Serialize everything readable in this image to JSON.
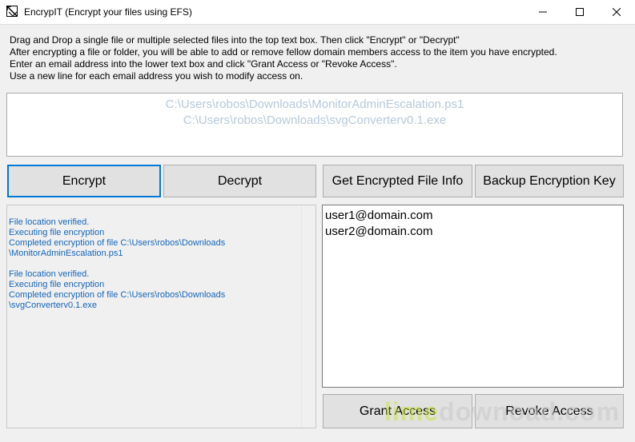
{
  "window": {
    "title": "EncrypIT (Encrypt your files using EFS)"
  },
  "instructions": [
    "Drag and Drop a single file or multiple selected files into the top text box. Then click \"Encrypt\" or \"Decrypt\"",
    "After encrypting a file or folder, you will be able to add or remove fellow domain members access to the item you have encrypted.",
    "Enter an email address into the lower text box and click \"Grant Access or \"Revoke Access\".",
    "Use a new line for each email address you wish to modify access on."
  ],
  "files": [
    "C:\\Users\\robos\\Downloads\\MonitorAdminEscalation.ps1",
    "C:\\Users\\robos\\Downloads\\svgConverterv0.1.exe"
  ],
  "buttons": {
    "encrypt": "Encrypt",
    "decrypt": "Decrypt",
    "get_info": "Get Encrypted File Info",
    "backup_key": "Backup Encryption Key",
    "grant": "Grant Access",
    "revoke": "Revoke Access"
  },
  "log": [
    "File location verified.",
    "Executing file encryption",
    "Completed encryption of file C:\\Users\\robos\\Downloads",
    "\\MonitorAdminEscalation.ps1",
    "",
    "File location verified.",
    "Executing file encryption",
    "Completed encryption of file C:\\Users\\robos\\Downloads",
    "\\svgConverterv0.1.exe"
  ],
  "emails": [
    "user1@domain.com",
    "user2@domain.com"
  ],
  "watermark": {
    "part1": "lime",
    "part2": "downoad.com"
  },
  "colors": {
    "accent": "#0078d7",
    "log_text": "#1565b8",
    "placeholder_text": "#b7c9dc"
  }
}
